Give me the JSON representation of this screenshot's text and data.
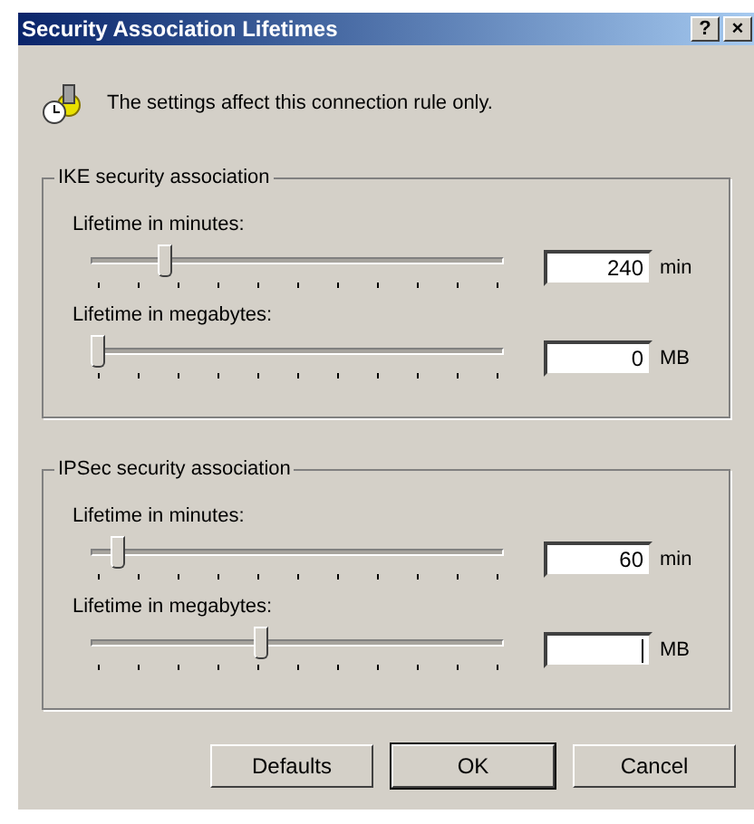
{
  "window": {
    "title": "Security Association Lifetimes",
    "buttons": [
      "?",
      "×"
    ]
  },
  "info": "The settings affect this connection rule only.",
  "groups": [
    {
      "title": "IKE security association",
      "rows": [
        {
          "label": "Lifetime in minutes:",
          "level": 0.17,
          "value": "240",
          "unit": "min",
          "focused": false
        },
        {
          "label": "Lifetime in megabytes:",
          "level": 0,
          "value": "0",
          "unit": "MB",
          "focused": false
        }
      ]
    },
    {
      "title": "IPSec security association",
      "rows": [
        {
          "label": "Lifetime in minutes:",
          "level": 0.05,
          "value": "60",
          "unit": "min",
          "focused": false
        },
        {
          "label": "Lifetime in megabytes:",
          "level": 0.41,
          "unit": "MB",
          "focused": true
        }
      ]
    }
  ],
  "buttons": [
    {
      "label": "Defaults",
      "default": false
    },
    {
      "label": "OK",
      "default": true
    },
    {
      "label": "Cancel",
      "default": false
    }
  ]
}
